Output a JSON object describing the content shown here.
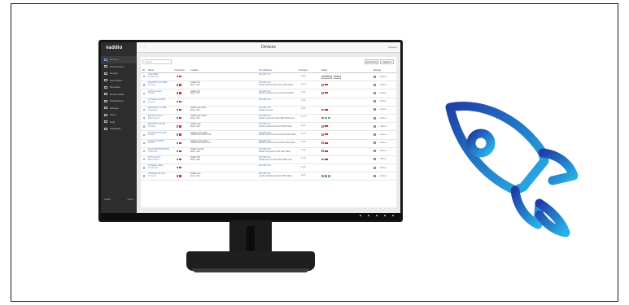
{
  "brand": {
    "logo": "vaddio"
  },
  "nav": [
    {
      "label": "Devices",
      "active": true
    },
    {
      "label": "Live Streams"
    },
    {
      "label": "Groups"
    },
    {
      "label": "Floor Plans"
    },
    {
      "label": "Firmware"
    },
    {
      "label": "Device Tasks"
    },
    {
      "label": "Notifications"
    },
    {
      "label": "Settings"
    },
    {
      "label": "Users"
    },
    {
      "label": "Help"
    },
    {
      "label": "Feedback"
    }
  ],
  "sidebar_footer": {
    "left": "Vaddio",
    "right": "Admin"
  },
  "topbar": {
    "arrows": "‹ ›",
    "title": "Devices",
    "user": "Admin ▾"
  },
  "toolbar": {
    "search_placeholder": "Search",
    "actions": [
      "Add Device",
      "Update ▾"
    ]
  },
  "columns": [
    "ID",
    "Name",
    "Connection",
    "Location",
    "IP / Hostname",
    "Firmware",
    "Status",
    "Manage"
  ],
  "rows": [
    {
      "name": "ClearVIEW",
      "sub": "Conference",
      "loc": "",
      "locsub": "",
      "ip": "192.168.0.11",
      "ipsub": "",
      "fw": "1.0.0",
      "fw_update": false,
      "status": "login"
    },
    {
      "name": "RoboSHOT 30 HDBT",
      "sub": "Training",
      "loc": "Vaddio HQ",
      "locsub": "Room 101",
      "ip": "192.168.0.12",
      "ipsub": "vaddio-roboshot-30e-0123-4567-89ab",
      "fw": "2.1.0",
      "fw_update": false,
      "status": "red"
    },
    {
      "name": "PTZ Conf Cam",
      "sub": "Huddle",
      "loc": "Vaddio HQ",
      "locsub": "Room 102",
      "ip": "192.168.0.13",
      "ipsub": "vaddio-conference-ptz-cam-0123-4567",
      "fw": "3.0.0",
      "fw_update": true,
      "status": "red"
    },
    {
      "name": "AV Bridge 2x1 Mini",
      "sub": "Lecture",
      "loc": "",
      "locsub": "",
      "ip": "192.168.0.14",
      "ipsub": "",
      "fw": "1.2.0",
      "fw_update": false,
      "status": "empty"
    },
    {
      "name": "RoboSHOT 12 USB",
      "sub": "Classroom",
      "loc": "Vaddio Lab North",
      "locsub": "Room 103",
      "ip": "192.168.0.15",
      "ipsub": "vaddio-usb-cam",
      "fw": "2.0.1",
      "fw_update": false,
      "status": "red"
    },
    {
      "name": "EasyIP 20 Cam",
      "sub": "Board Room",
      "loc": "Vaddio Lab South",
      "locsub": "Room 104",
      "ip": "192.168.0.16",
      "ipsub": "vaddio-easyip-20-0123-4567-89ab-cdef",
      "fw": "1.1.0",
      "fw_update": false,
      "status": "green"
    },
    {
      "name": "RoboSHOT 12 HD",
      "sub": "Training",
      "loc": "Vaddio Lab",
      "locsub": "Room 105",
      "ip": "192.168.0.17",
      "ipsub": "vaddio-roboshot-12-0123-4567-89ab",
      "fw": "2.2.0",
      "fw_update": false,
      "status": "red"
    },
    {
      "name": "RoboSHOT 20 UHD",
      "sub": "Lecture",
      "loc": "Vaddio Annex East",
      "locsub": "Conference Room 106",
      "ip": "192.168.0.18",
      "ipsub": "vaddio-roboshot-20-uhd-0123-4567-89ab",
      "fw": "3.1.0",
      "fw_update": false,
      "status": "red"
    },
    {
      "name": "ConferenceSHOT",
      "sub": "Huddle",
      "loc": "Vaddio Annex West",
      "locsub": "Conference Room 107",
      "ip": "192.168.0.19",
      "ipsub": "vaddio-conferenceshot-0123-4567-89ab",
      "fw": "1.3.0",
      "fw_update": false,
      "status": "red"
    },
    {
      "name": "EasyUSB MixMASTER",
      "sub": "Classroom",
      "loc": "Vaddio Central",
      "locsub": "Room 108",
      "ip": "192.168.0.20",
      "ipsub": "vaddio-mixmaster-0123-4567-89ab",
      "fw": "2.3.0",
      "fw_update": false,
      "status": "red"
    },
    {
      "name": "PTZ Cam Pro",
      "sub": "Board Room",
      "loc": "Vaddio HQ",
      "locsub": "Room 109",
      "ip": "192.168.0.21",
      "ipsub": "vaddio-ptz-pro-0123-4567-89ab-cdef",
      "fw": "1.4.0",
      "fw_update": false,
      "status": "red"
    },
    {
      "name": "AV Bridge Matrix",
      "sub": "Conference",
      "loc": "",
      "locsub": "",
      "ip": "192.168.0.22",
      "ipsub": "",
      "fw": "2.4.0",
      "fw_update": false,
      "status": "empty"
    },
    {
      "name": "HD Bridge 4K Cam",
      "sub": "Training",
      "loc": "Vaddio Lab",
      "locsub": "Room 110",
      "ip": "192.168.0.23",
      "ipsub": "vaddio-hdbridge-4k-0123-4567-89ab",
      "fw": "3.2.0",
      "fw_update": false,
      "status": "green"
    }
  ],
  "manage": {
    "menu": "More ▾"
  },
  "colors": {
    "accent": "#2f7bd4",
    "rocket_gradient": [
      "#1f3fa6",
      "#28b4e8"
    ]
  }
}
